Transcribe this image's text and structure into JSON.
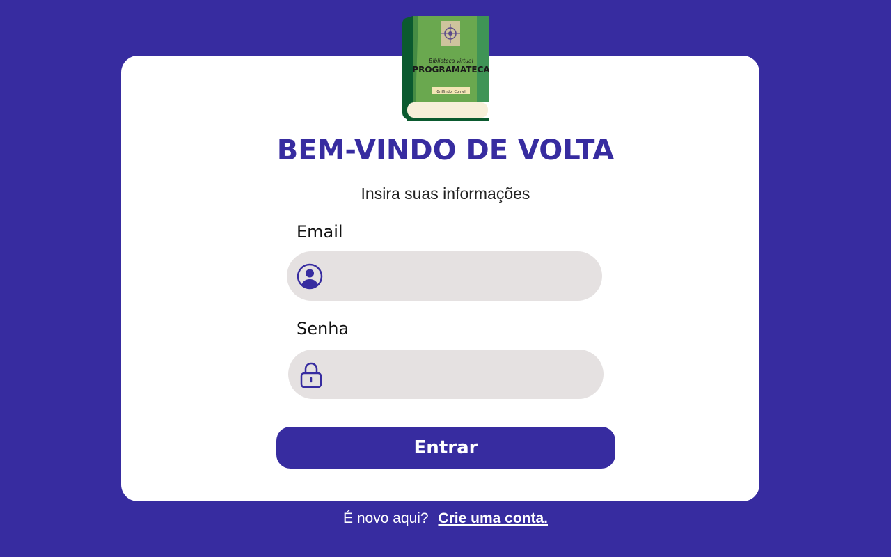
{
  "logo": {
    "line1": "Biblioteca virtual",
    "line2": "PROGRAMATECA",
    "author": "Griffindor Cornel"
  },
  "header": {
    "title": "BEM-VINDO DE VOLTA",
    "subtitle": "Insira suas informações"
  },
  "form": {
    "email_label": "Email",
    "email_value": "",
    "password_label": "Senha",
    "password_value": "",
    "submit_label": "Entrar"
  },
  "footer": {
    "prompt": "É novo aqui?",
    "link": "Crie uma conta."
  },
  "colors": {
    "background": "#372ca0",
    "card": "#ffffff",
    "input": "#e5e1e1",
    "accent": "#372ca0",
    "book_cover": "#6aa84f",
    "book_spine": "#0b5a2f"
  },
  "icons": {
    "email": "user-circle-icon",
    "password": "lock-icon"
  }
}
